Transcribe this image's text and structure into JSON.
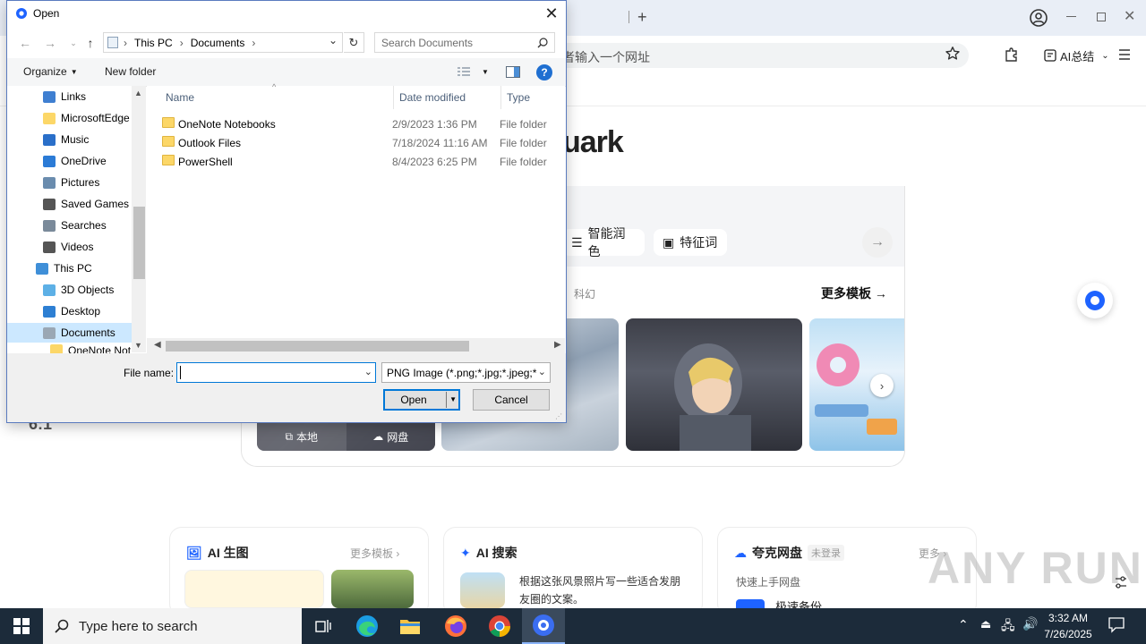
{
  "browser": {
    "address_placeholder": "者输入一个网址",
    "ai_summary": "AI总结",
    "logo_fragment": "uark",
    "chips": [
      "智能润色",
      "特征词"
    ],
    "category": "科幻",
    "more_templates": "更多模板",
    "local_label": "本地",
    "net_label": "网盘",
    "ratio": "6:1",
    "cards": [
      {
        "title": "AI 生图",
        "more": "更多模板"
      },
      {
        "title": "AI 搜索",
        "text": "根据这张风景照片写一些适合发朋友圈的文案。"
      },
      {
        "title": "夸克网盘",
        "badge": "未登录",
        "more": "更多",
        "sub": "快速上手网盘",
        "sub2": "极速备份"
      }
    ],
    "watermark": "ANY RUN"
  },
  "dialog": {
    "title": "Open",
    "breadcrumb": [
      "This PC",
      "Documents"
    ],
    "search_placeholder": "Search Documents",
    "organize": "Organize",
    "new_folder": "New folder",
    "nav": [
      {
        "label": "Links",
        "icon": "links-icon"
      },
      {
        "label": "MicrosoftEdge",
        "icon": "folder-icon"
      },
      {
        "label": "Music",
        "icon": "music-icon"
      },
      {
        "label": "OneDrive",
        "icon": "onedrive-icon"
      },
      {
        "label": "Pictures",
        "icon": "pictures-icon"
      },
      {
        "label": "Saved Games",
        "icon": "saved-games-icon"
      },
      {
        "label": "Searches",
        "icon": "searches-icon"
      },
      {
        "label": "Videos",
        "icon": "videos-icon"
      },
      {
        "label": "This PC",
        "icon": "this-pc-icon"
      },
      {
        "label": "3D Objects",
        "icon": "3d-objects-icon"
      },
      {
        "label": "Desktop",
        "icon": "desktop-icon"
      },
      {
        "label": "Documents",
        "icon": "documents-icon"
      },
      {
        "label": "OneNote Not",
        "icon": "folder-icon"
      }
    ],
    "columns": {
      "name": "Name",
      "date": "Date modified",
      "type": "Type"
    },
    "files": [
      {
        "name": "OneNote Notebooks",
        "date": "2/9/2023 1:36 PM",
        "type": "File folder"
      },
      {
        "name": "Outlook Files",
        "date": "7/18/2024 11:16 AM",
        "type": "File folder"
      },
      {
        "name": "PowerShell",
        "date": "8/4/2023 6:25 PM",
        "type": "File folder"
      }
    ],
    "file_name_label": "File name:",
    "file_name_value": "",
    "filter": "PNG Image (*.png;*.jpg;*.jpeg;*",
    "open": "Open",
    "cancel": "Cancel"
  },
  "taskbar": {
    "search_placeholder": "Type here to search",
    "time": "3:32 AM",
    "date": "7/26/2025"
  }
}
